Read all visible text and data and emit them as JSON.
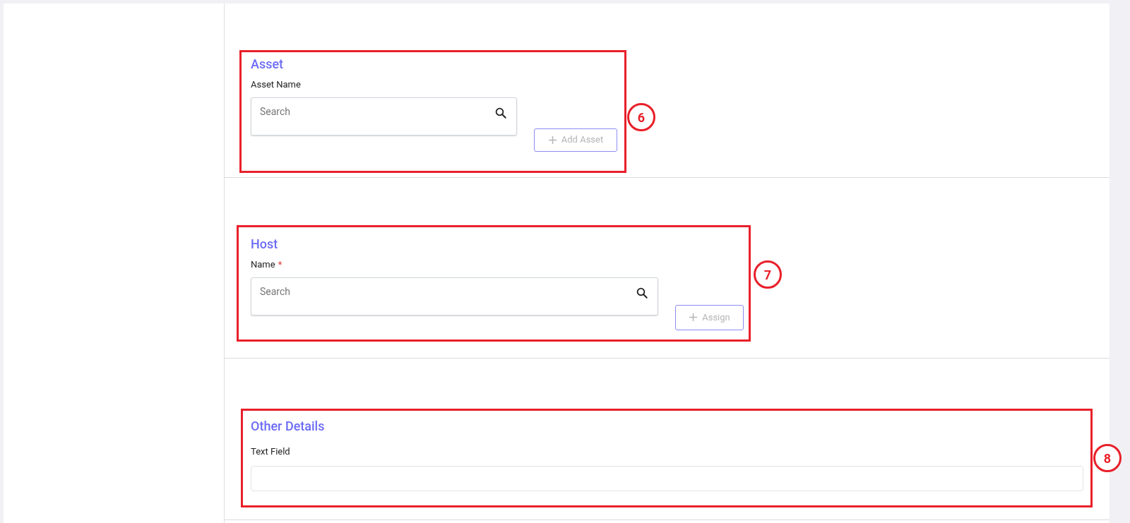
{
  "sections": [
    {
      "title": "Asset",
      "annotation": "6",
      "field": {
        "kind": "search",
        "label": "Asset Name",
        "placeholder": "Search"
      },
      "button": {
        "label": "Add Asset",
        "disabled": true
      }
    },
    {
      "title": "Host",
      "annotation": "7",
      "field": {
        "kind": "search",
        "label": "Name",
        "required_marker": "*",
        "placeholder": "Search"
      },
      "button": {
        "label": "Assign",
        "disabled": true
      }
    },
    {
      "title": "Other Details",
      "annotation": "8",
      "field": {
        "kind": "text",
        "label": "Text Field"
      }
    }
  ]
}
